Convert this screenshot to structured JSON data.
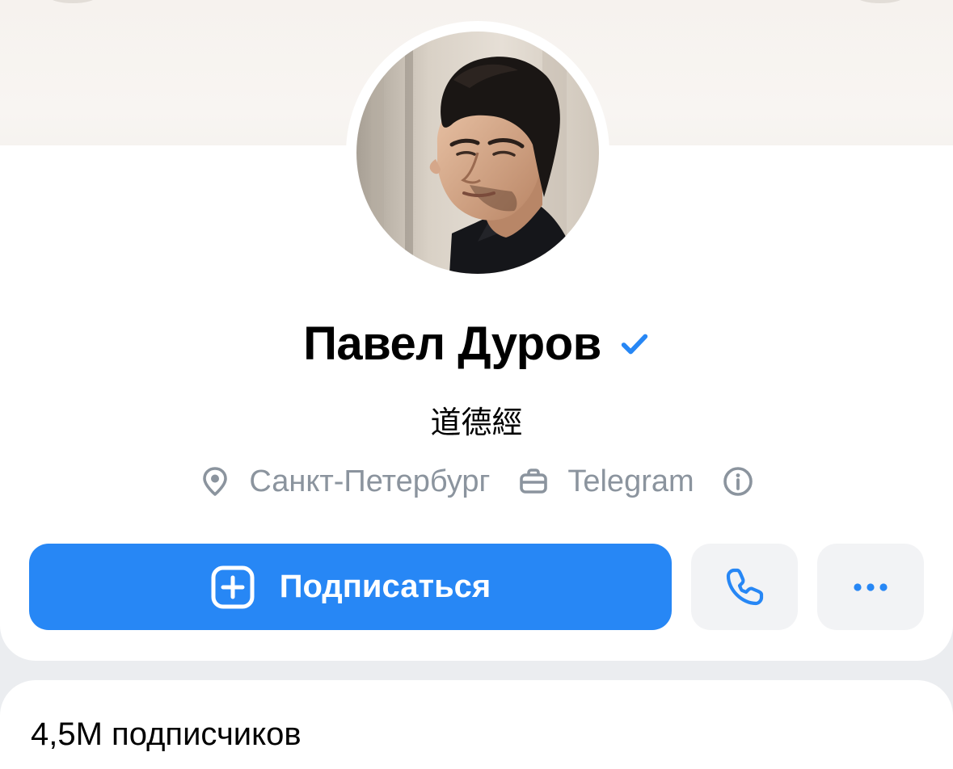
{
  "profile": {
    "name": "Павел Дуров",
    "status": "道德經",
    "location": "Санкт-Петербург",
    "work": "Telegram",
    "verified_color": "#2787f5"
  },
  "actions": {
    "subscribe_label": "Подписаться",
    "call_icon": "phone-icon",
    "more_icon": "more-icon",
    "accent_color": "#2787f5"
  },
  "stats": {
    "followers_label": "4,5M подписчиков"
  }
}
